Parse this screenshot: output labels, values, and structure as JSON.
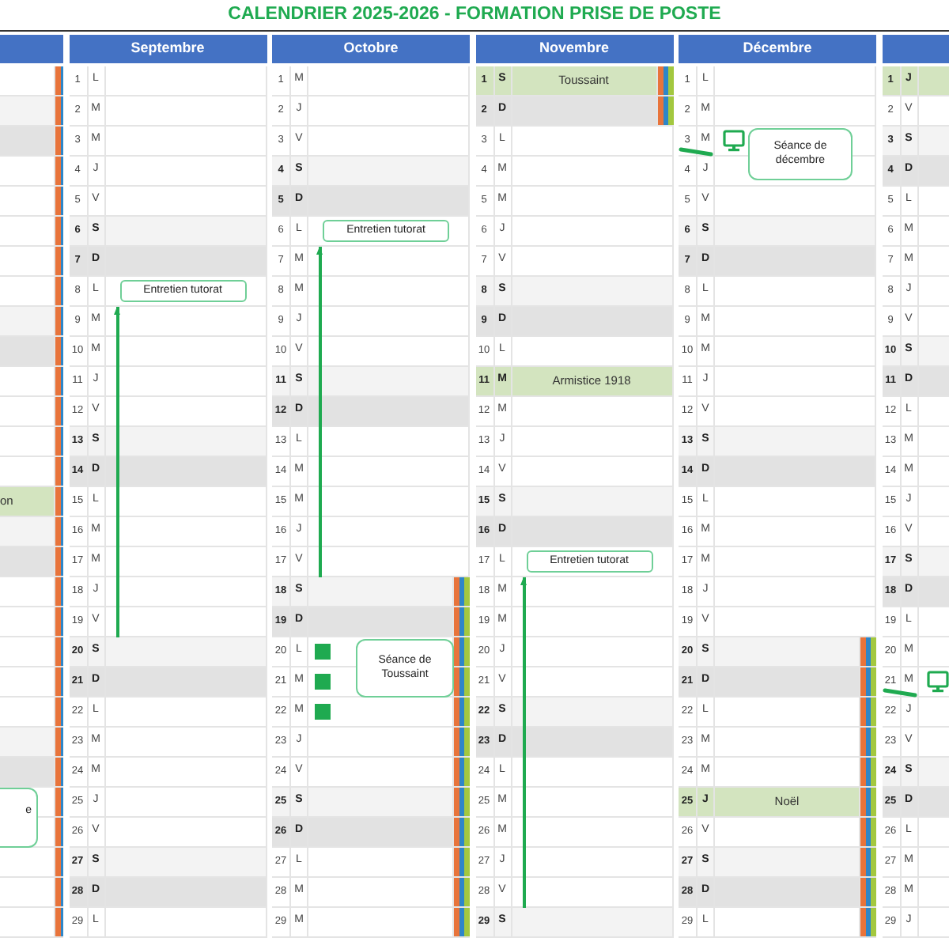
{
  "title": "CALENDRIER 2025-2026 - FORMATION PRISE DE POSTE",
  "months": [
    {
      "days": [
        {
          "kind": "weekday",
          "vacation": true
        },
        {
          "kind": "saturday",
          "vacation": true
        },
        {
          "kind": "sunday",
          "vacation": true
        },
        {
          "kind": "weekday",
          "vacation": true
        },
        {
          "kind": "weekday",
          "vacation": true
        },
        {
          "kind": "weekday",
          "vacation": true
        },
        {
          "kind": "weekday",
          "vacation": true
        },
        {
          "kind": "weekday",
          "vacation": true
        },
        {
          "kind": "saturday",
          "vacation": true
        },
        {
          "kind": "sunday",
          "vacation": true
        },
        {
          "kind": "weekday",
          "vacation": true
        },
        {
          "kind": "weekday",
          "vacation": true
        },
        {
          "kind": "weekday",
          "vacation": true
        },
        {
          "kind": "weekday",
          "vacation": true
        },
        {
          "kind": "holiday",
          "vacation": true,
          "label": "on"
        },
        {
          "kind": "saturday",
          "vacation": true
        },
        {
          "kind": "sunday",
          "vacation": true
        },
        {
          "kind": "weekday",
          "vacation": true
        },
        {
          "kind": "weekday",
          "vacation": true
        },
        {
          "kind": "weekday",
          "vacation": true
        },
        {
          "kind": "weekday",
          "vacation": true
        },
        {
          "kind": "weekday",
          "vacation": true
        },
        {
          "kind": "saturday",
          "vacation": true
        },
        {
          "kind": "sunday",
          "vacation": true
        },
        {
          "kind": "weekday",
          "vacation": true,
          "event": {
            "kind": "clipped",
            "text": "e"
          }
        },
        {
          "kind": "weekday",
          "vacation": true
        },
        {
          "kind": "weekday",
          "vacation": true
        },
        {
          "kind": "weekday",
          "vacation": true
        },
        {
          "kind": "weekday",
          "vacation": true
        }
      ]
    },
    {
      "name": "Septembre",
      "days": [
        {
          "num": "1",
          "wd": "L",
          "kind": "weekday",
          "vacation": false,
          "line": false
        },
        {
          "num": "2",
          "wd": "M",
          "kind": "weekday",
          "vacation": false,
          "line": false
        },
        {
          "num": "3",
          "wd": "M",
          "kind": "weekday",
          "vacation": false,
          "line": false
        },
        {
          "num": "4",
          "wd": "J",
          "kind": "weekday",
          "vacation": false,
          "line": false
        },
        {
          "num": "5",
          "wd": "V",
          "kind": "weekday",
          "vacation": false,
          "line": false
        },
        {
          "num": "6",
          "wd": "S",
          "kind": "saturday",
          "vacation": false,
          "line": false
        },
        {
          "num": "7",
          "wd": "D",
          "kind": "sunday",
          "vacation": false,
          "line": false
        },
        {
          "num": "8",
          "wd": "L",
          "kind": "weekday",
          "vacation": false,
          "line": false,
          "event": {
            "kind": "tutorat",
            "text": "Entretien tutorat"
          }
        },
        {
          "num": "9",
          "wd": "M",
          "kind": "weekday",
          "vacation": false,
          "line": true
        },
        {
          "num": "10",
          "wd": "M",
          "kind": "weekday",
          "vacation": false,
          "line": true
        },
        {
          "num": "11",
          "wd": "J",
          "kind": "weekday",
          "vacation": false,
          "line": true
        },
        {
          "num": "12",
          "wd": "V",
          "kind": "weekday",
          "vacation": false,
          "line": true
        },
        {
          "num": "13",
          "wd": "S",
          "kind": "saturday",
          "vacation": false,
          "line": true
        },
        {
          "num": "14",
          "wd": "D",
          "kind": "sunday",
          "vacation": false,
          "line": true
        },
        {
          "num": "15",
          "wd": "L",
          "kind": "weekday",
          "vacation": false,
          "line": true
        },
        {
          "num": "16",
          "wd": "M",
          "kind": "weekday",
          "vacation": false,
          "line": true
        },
        {
          "num": "17",
          "wd": "M",
          "kind": "weekday",
          "vacation": false,
          "line": true
        },
        {
          "num": "18",
          "wd": "J",
          "kind": "weekday",
          "vacation": false,
          "line": true
        },
        {
          "num": "19",
          "wd": "V",
          "kind": "weekday",
          "vacation": false,
          "line": true
        },
        {
          "num": "20",
          "wd": "S",
          "kind": "saturday",
          "vacation": false,
          "line": false
        },
        {
          "num": "21",
          "wd": "D",
          "kind": "sunday",
          "vacation": false,
          "line": false
        },
        {
          "num": "22",
          "wd": "L",
          "kind": "weekday",
          "vacation": false,
          "line": false
        },
        {
          "num": "23",
          "wd": "M",
          "kind": "weekday",
          "vacation": false,
          "line": false
        },
        {
          "num": "24",
          "wd": "M",
          "kind": "weekday",
          "vacation": false,
          "line": false
        },
        {
          "num": "25",
          "wd": "J",
          "kind": "weekday",
          "vacation": false,
          "line": false
        },
        {
          "num": "26",
          "wd": "V",
          "kind": "weekday",
          "vacation": false,
          "line": false
        },
        {
          "num": "27",
          "wd": "S",
          "kind": "saturday",
          "vacation": false,
          "line": false
        },
        {
          "num": "28",
          "wd": "D",
          "kind": "sunday",
          "vacation": false,
          "line": false
        },
        {
          "num": "29",
          "wd": "L",
          "kind": "weekday",
          "vacation": false,
          "line": false
        }
      ]
    },
    {
      "name": "Octobre",
      "days": [
        {
          "num": "1",
          "wd": "M",
          "kind": "weekday",
          "vacation": false,
          "line": false,
          "marker": false
        },
        {
          "num": "2",
          "wd": "J",
          "kind": "weekday",
          "vacation": false,
          "line": false,
          "marker": false
        },
        {
          "num": "3",
          "wd": "V",
          "kind": "weekday",
          "vacation": false,
          "line": false,
          "marker": false
        },
        {
          "num": "4",
          "wd": "S",
          "kind": "saturday",
          "vacation": false,
          "line": false,
          "marker": false
        },
        {
          "num": "5",
          "wd": "D",
          "kind": "sunday",
          "vacation": false,
          "line": false,
          "marker": false
        },
        {
          "num": "6",
          "wd": "L",
          "kind": "weekday",
          "vacation": false,
          "line": false,
          "marker": false,
          "event": {
            "kind": "tutorat",
            "text": "Entretien tutorat"
          }
        },
        {
          "num": "7",
          "wd": "M",
          "kind": "weekday",
          "vacation": false,
          "line": true,
          "marker": false
        },
        {
          "num": "8",
          "wd": "M",
          "kind": "weekday",
          "vacation": false,
          "line": true,
          "marker": false
        },
        {
          "num": "9",
          "wd": "J",
          "kind": "weekday",
          "vacation": false,
          "line": true,
          "marker": false
        },
        {
          "num": "10",
          "wd": "V",
          "kind": "weekday",
          "vacation": false,
          "line": true,
          "marker": false
        },
        {
          "num": "11",
          "wd": "S",
          "kind": "saturday",
          "vacation": false,
          "line": true,
          "marker": false
        },
        {
          "num": "12",
          "wd": "D",
          "kind": "sunday",
          "vacation": false,
          "line": true,
          "marker": false
        },
        {
          "num": "13",
          "wd": "L",
          "kind": "weekday",
          "vacation": false,
          "line": true,
          "marker": false
        },
        {
          "num": "14",
          "wd": "M",
          "kind": "weekday",
          "vacation": false,
          "line": true,
          "marker": false
        },
        {
          "num": "15",
          "wd": "M",
          "kind": "weekday",
          "vacation": false,
          "line": true,
          "marker": false
        },
        {
          "num": "16",
          "wd": "J",
          "kind": "weekday",
          "vacation": false,
          "line": true,
          "marker": false
        },
        {
          "num": "17",
          "wd": "V",
          "kind": "weekday",
          "vacation": false,
          "line": true,
          "marker": false
        },
        {
          "num": "18",
          "wd": "S",
          "kind": "saturday",
          "vacation": true,
          "line": false,
          "marker": false
        },
        {
          "num": "19",
          "wd": "D",
          "kind": "sunday",
          "vacation": true,
          "line": false,
          "marker": false
        },
        {
          "num": "20",
          "wd": "L",
          "kind": "weekday",
          "vacation": true,
          "line": false,
          "marker": true,
          "event": {
            "kind": "callout",
            "text": "Séance de Toussaint"
          }
        },
        {
          "num": "21",
          "wd": "M",
          "kind": "weekday",
          "vacation": true,
          "line": false,
          "marker": true
        },
        {
          "num": "22",
          "wd": "M",
          "kind": "weekday",
          "vacation": true,
          "line": false,
          "marker": true
        },
        {
          "num": "23",
          "wd": "J",
          "kind": "weekday",
          "vacation": true,
          "line": false,
          "marker": false
        },
        {
          "num": "24",
          "wd": "V",
          "kind": "weekday",
          "vacation": true,
          "line": false,
          "marker": false
        },
        {
          "num": "25",
          "wd": "S",
          "kind": "saturday",
          "vacation": true,
          "line": false,
          "marker": false
        },
        {
          "num": "26",
          "wd": "D",
          "kind": "sunday",
          "vacation": true,
          "line": false,
          "marker": false
        },
        {
          "num": "27",
          "wd": "L",
          "kind": "weekday",
          "vacation": true,
          "line": false,
          "marker": false
        },
        {
          "num": "28",
          "wd": "M",
          "kind": "weekday",
          "vacation": true,
          "line": false,
          "marker": false
        },
        {
          "num": "29",
          "wd": "M",
          "kind": "weekday",
          "vacation": true,
          "line": false,
          "marker": false
        }
      ]
    },
    {
      "name": "Novembre",
      "days": [
        {
          "num": "1",
          "wd": "S",
          "kind": "holiday",
          "vacation": true,
          "line": false,
          "label": "Toussaint"
        },
        {
          "num": "2",
          "wd": "D",
          "kind": "sunday",
          "vacation": true,
          "line": false
        },
        {
          "num": "3",
          "wd": "L",
          "kind": "weekday",
          "vacation": false,
          "line": false
        },
        {
          "num": "4",
          "wd": "M",
          "kind": "weekday",
          "vacation": false,
          "line": false
        },
        {
          "num": "5",
          "wd": "M",
          "kind": "weekday",
          "vacation": false,
          "line": false
        },
        {
          "num": "6",
          "wd": "J",
          "kind": "weekday",
          "vacation": false,
          "line": false
        },
        {
          "num": "7",
          "wd": "V",
          "kind": "weekday",
          "vacation": false,
          "line": false
        },
        {
          "num": "8",
          "wd": "S",
          "kind": "saturday",
          "vacation": false,
          "line": false
        },
        {
          "num": "9",
          "wd": "D",
          "kind": "sunday",
          "vacation": false,
          "line": false
        },
        {
          "num": "10",
          "wd": "L",
          "kind": "weekday",
          "vacation": false,
          "line": false
        },
        {
          "num": "11",
          "wd": "M",
          "kind": "holiday",
          "vacation": false,
          "line": false,
          "label": "Armistice 1918"
        },
        {
          "num": "12",
          "wd": "M",
          "kind": "weekday",
          "vacation": false,
          "line": false
        },
        {
          "num": "13",
          "wd": "J",
          "kind": "weekday",
          "vacation": false,
          "line": false
        },
        {
          "num": "14",
          "wd": "V",
          "kind": "weekday",
          "vacation": false,
          "line": false
        },
        {
          "num": "15",
          "wd": "S",
          "kind": "saturday",
          "vacation": false,
          "line": false
        },
        {
          "num": "16",
          "wd": "D",
          "kind": "sunday",
          "vacation": false,
          "line": false
        },
        {
          "num": "17",
          "wd": "L",
          "kind": "weekday",
          "vacation": false,
          "line": false,
          "event": {
            "kind": "tutorat",
            "text": "Entretien tutorat"
          }
        },
        {
          "num": "18",
          "wd": "M",
          "kind": "weekday",
          "vacation": false,
          "line": true
        },
        {
          "num": "19",
          "wd": "M",
          "kind": "weekday",
          "vacation": false,
          "line": true
        },
        {
          "num": "20",
          "wd": "J",
          "kind": "weekday",
          "vacation": false,
          "line": true
        },
        {
          "num": "21",
          "wd": "V",
          "kind": "weekday",
          "vacation": false,
          "line": true
        },
        {
          "num": "22",
          "wd": "S",
          "kind": "saturday",
          "vacation": false,
          "line": true
        },
        {
          "num": "23",
          "wd": "D",
          "kind": "sunday",
          "vacation": false,
          "line": true
        },
        {
          "num": "24",
          "wd": "L",
          "kind": "weekday",
          "vacation": false,
          "line": true
        },
        {
          "num": "25",
          "wd": "M",
          "kind": "weekday",
          "vacation": false,
          "line": true
        },
        {
          "num": "26",
          "wd": "M",
          "kind": "weekday",
          "vacation": false,
          "line": true
        },
        {
          "num": "27",
          "wd": "J",
          "kind": "weekday",
          "vacation": false,
          "line": true
        },
        {
          "num": "28",
          "wd": "V",
          "kind": "weekday",
          "vacation": false,
          "line": true
        },
        {
          "num": "29",
          "wd": "S",
          "kind": "saturday",
          "vacation": false,
          "line": false
        }
      ]
    },
    {
      "name": "Décembre",
      "days": [
        {
          "num": "1",
          "wd": "L",
          "kind": "weekday",
          "vacation": false
        },
        {
          "num": "2",
          "wd": "M",
          "kind": "weekday",
          "vacation": false
        },
        {
          "num": "3",
          "wd": "M",
          "kind": "weekday",
          "vacation": false,
          "event": {
            "kind": "visio",
            "text": "Séance de décembre"
          }
        },
        {
          "num": "4",
          "wd": "J",
          "kind": "weekday",
          "vacation": false
        },
        {
          "num": "5",
          "wd": "V",
          "kind": "weekday",
          "vacation": false
        },
        {
          "num": "6",
          "wd": "S",
          "kind": "saturday",
          "vacation": false
        },
        {
          "num": "7",
          "wd": "D",
          "kind": "sunday",
          "vacation": false
        },
        {
          "num": "8",
          "wd": "L",
          "kind": "weekday",
          "vacation": false
        },
        {
          "num": "9",
          "wd": "M",
          "kind": "weekday",
          "vacation": false
        },
        {
          "num": "10",
          "wd": "M",
          "kind": "weekday",
          "vacation": false
        },
        {
          "num": "11",
          "wd": "J",
          "kind": "weekday",
          "vacation": false
        },
        {
          "num": "12",
          "wd": "V",
          "kind": "weekday",
          "vacation": false
        },
        {
          "num": "13",
          "wd": "S",
          "kind": "saturday",
          "vacation": false
        },
        {
          "num": "14",
          "wd": "D",
          "kind": "sunday",
          "vacation": false
        },
        {
          "num": "15",
          "wd": "L",
          "kind": "weekday",
          "vacation": false
        },
        {
          "num": "16",
          "wd": "M",
          "kind": "weekday",
          "vacation": false
        },
        {
          "num": "17",
          "wd": "M",
          "kind": "weekday",
          "vacation": false
        },
        {
          "num": "18",
          "wd": "J",
          "kind": "weekday",
          "vacation": false
        },
        {
          "num": "19",
          "wd": "V",
          "kind": "weekday",
          "vacation": false
        },
        {
          "num": "20",
          "wd": "S",
          "kind": "saturday",
          "vacation": true
        },
        {
          "num": "21",
          "wd": "D",
          "kind": "sunday",
          "vacation": true
        },
        {
          "num": "22",
          "wd": "L",
          "kind": "weekday",
          "vacation": true
        },
        {
          "num": "23",
          "wd": "M",
          "kind": "weekday",
          "vacation": true
        },
        {
          "num": "24",
          "wd": "M",
          "kind": "weekday",
          "vacation": true
        },
        {
          "num": "25",
          "wd": "J",
          "kind": "holiday",
          "vacation": true,
          "label": "Noël"
        },
        {
          "num": "26",
          "wd": "V",
          "kind": "weekday",
          "vacation": true
        },
        {
          "num": "27",
          "wd": "S",
          "kind": "saturday",
          "vacation": true
        },
        {
          "num": "28",
          "wd": "D",
          "kind": "sunday",
          "vacation": true
        },
        {
          "num": "29",
          "wd": "L",
          "kind": "weekday",
          "vacation": true
        }
      ]
    },
    {
      "days": [
        {
          "num": "1",
          "wd": "J",
          "kind": "holiday"
        },
        {
          "num": "2",
          "wd": "V",
          "kind": "weekday"
        },
        {
          "num": "3",
          "wd": "S",
          "kind": "saturday"
        },
        {
          "num": "4",
          "wd": "D",
          "kind": "sunday"
        },
        {
          "num": "5",
          "wd": "L",
          "kind": "weekday"
        },
        {
          "num": "6",
          "wd": "M",
          "kind": "weekday"
        },
        {
          "num": "7",
          "wd": "M",
          "kind": "weekday"
        },
        {
          "num": "8",
          "wd": "J",
          "kind": "weekday"
        },
        {
          "num": "9",
          "wd": "V",
          "kind": "weekday"
        },
        {
          "num": "10",
          "wd": "S",
          "kind": "saturday"
        },
        {
          "num": "11",
          "wd": "D",
          "kind": "sunday"
        },
        {
          "num": "12",
          "wd": "L",
          "kind": "weekday"
        },
        {
          "num": "13",
          "wd": "M",
          "kind": "weekday"
        },
        {
          "num": "14",
          "wd": "M",
          "kind": "weekday"
        },
        {
          "num": "15",
          "wd": "J",
          "kind": "weekday"
        },
        {
          "num": "16",
          "wd": "V",
          "kind": "weekday"
        },
        {
          "num": "17",
          "wd": "S",
          "kind": "saturday"
        },
        {
          "num": "18",
          "wd": "D",
          "kind": "sunday"
        },
        {
          "num": "19",
          "wd": "L",
          "kind": "weekday"
        },
        {
          "num": "20",
          "wd": "M",
          "kind": "weekday"
        },
        {
          "num": "21",
          "wd": "M",
          "kind": "weekday",
          "event": {
            "kind": "visio"
          }
        },
        {
          "num": "22",
          "wd": "J",
          "kind": "weekday"
        },
        {
          "num": "23",
          "wd": "V",
          "kind": "weekday"
        },
        {
          "num": "24",
          "wd": "S",
          "kind": "saturday"
        },
        {
          "num": "25",
          "wd": "D",
          "kind": "sunday"
        },
        {
          "num": "26",
          "wd": "L",
          "kind": "weekday"
        },
        {
          "num": "27",
          "wd": "M",
          "kind": "weekday"
        },
        {
          "num": "28",
          "wd": "M",
          "kind": "weekday"
        },
        {
          "num": "29",
          "wd": "J",
          "kind": "weekday"
        }
      ]
    }
  ]
}
